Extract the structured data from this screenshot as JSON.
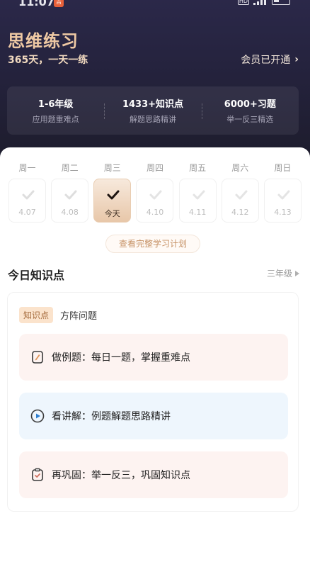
{
  "status_bar": {
    "time": "11:07",
    "app_badge": "吉",
    "hd_label": "HD"
  },
  "hero": {
    "title": "思维练习",
    "subtitle": "365天，一天一练",
    "member_status": "会员已开通",
    "stats": [
      {
        "value": "1-6年级",
        "label": "应用题重难点"
      },
      {
        "value": "1433+知识点",
        "label": "解题思路精讲"
      },
      {
        "value": "6000+习题",
        "label": "举一反三精选"
      }
    ]
  },
  "week": {
    "days": [
      {
        "name": "周一",
        "date": "4.07",
        "done": true,
        "today": false
      },
      {
        "name": "周二",
        "date": "4.08",
        "done": true,
        "today": false
      },
      {
        "name": "周三",
        "date": "今天",
        "done": true,
        "today": true
      },
      {
        "name": "周四",
        "date": "4.10",
        "done": false,
        "today": false
      },
      {
        "name": "周五",
        "date": "4.11",
        "done": false,
        "today": false
      },
      {
        "name": "周六",
        "date": "4.12",
        "done": false,
        "today": false
      },
      {
        "name": "周日",
        "date": "4.13",
        "done": false,
        "today": false
      }
    ],
    "plan_button": "查看完整学习计划"
  },
  "today": {
    "section_title": "今日知识点",
    "grade": "三年级",
    "topic_tag": "知识点",
    "topic_name": "方阵问题",
    "tasks": [
      {
        "label": "做例题：每日一题，掌握重难点",
        "icon": "pencil-icon",
        "color": "#c98a5c"
      },
      {
        "label": "看讲解：例题解题思路精讲",
        "icon": "play-icon",
        "color": "#2f7fd0"
      },
      {
        "label": "再巩固：举一反三，巩固知识点",
        "icon": "clipboard-icon",
        "color": "#d07060"
      }
    ]
  },
  "colors": {
    "accent_gold": "#efc9a4",
    "hero_bg": "#25233e",
    "today_highlight": "#e8c7a9"
  }
}
